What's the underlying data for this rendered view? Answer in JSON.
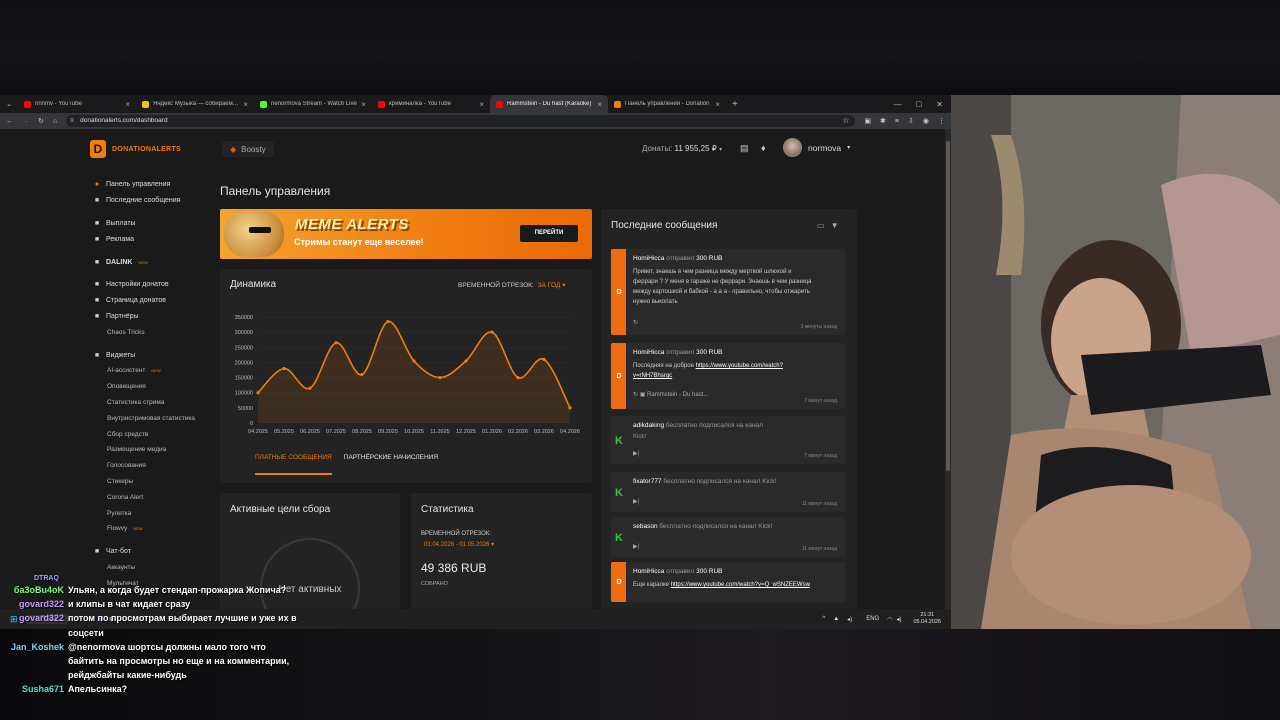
{
  "browser": {
    "tabs": [
      {
        "title": "nnnmv - YouTube",
        "icon": "youtube-icon",
        "color": "#ff0000"
      },
      {
        "title": "Яндекс Музыка — собираем мы",
        "icon": "yandex-music-icon",
        "color": "#f8c200"
      },
      {
        "title": "nenormova Stream - Watch Live",
        "icon": "kick-icon",
        "color": "#53fc18"
      },
      {
        "title": "криминалка - YouTube",
        "icon": "youtube-icon",
        "color": "#ff0000"
      },
      {
        "title": "Rammstein - Du hast (Karaoke)",
        "icon": "youtube-icon",
        "color": "#ff0000"
      },
      {
        "title": "Панель управления - Donation",
        "icon": "donationalerts-icon",
        "color": "#f57d07"
      }
    ],
    "url": "donationalerts.com/dashboard"
  },
  "topnav": {
    "logo": "DONATIONALERTS",
    "boosty": "Boosty",
    "donats_label": "Донаты:",
    "donats_value": "11 955,25 ₽",
    "username": "normova"
  },
  "sidebar": {
    "items": [
      {
        "label": "Панель управления",
        "icon": "dashboard-icon",
        "active": true
      },
      {
        "label": "Последние сообщения",
        "icon": "messages-icon"
      },
      {
        "label": "Выплаты",
        "icon": "payouts-icon"
      },
      {
        "label": "Реклама",
        "icon": "ads-icon"
      },
      {
        "label": "DALINK",
        "icon": "dalink-icon",
        "new": "NEW"
      },
      {
        "label": "Настройки донатов",
        "icon": "settings-icon"
      },
      {
        "label": "Страница донатов",
        "icon": "page-icon"
      },
      {
        "label": "Партнёры",
        "icon": "partners-icon"
      },
      {
        "label": "Chaos Tricks",
        "sub": true
      },
      {
        "label": "Виджеты",
        "icon": "widgets-icon"
      },
      {
        "label": "AI-ассистент",
        "sub": true,
        "new": "NEW"
      },
      {
        "label": "Оповещения",
        "sub": true
      },
      {
        "label": "Статистика стрима",
        "sub": true
      },
      {
        "label": "Внутристримовая статистика",
        "sub": true
      },
      {
        "label": "Сбор средств",
        "sub": true
      },
      {
        "label": "Размещение медиа",
        "sub": true
      },
      {
        "label": "Голосования",
        "sub": true
      },
      {
        "label": "Стикеры",
        "sub": true
      },
      {
        "label": "Corona Alert",
        "sub": true
      },
      {
        "label": "Рулетка",
        "sub": true
      },
      {
        "label": "Flowvy",
        "sub": true,
        "new": "NEW"
      },
      {
        "label": "Чат-бот",
        "icon": "bot-icon"
      },
      {
        "label": "Аккаунты",
        "sub": true
      },
      {
        "label": "Мультичат",
        "sub": true
      }
    ]
  },
  "main": {
    "title": "Панель управления",
    "banner": {
      "title": "MEME ALERTS",
      "subtitle": "Стримы станут еще веселее!",
      "button": "ПЕРЕЙТИ"
    },
    "dynamics": {
      "title": "Динамика",
      "period_label": "ВРЕМЕННОЙ ОТРЕЗОК:",
      "period_value": "ЗА ГОД",
      "tab_paid": "ПЛАТНЫЕ СООБЩЕНИЯ",
      "tab_partner": "ПАРТНЁРСКИЕ НАЧИСЛЕНИЯ"
    },
    "goals": {
      "title": "Активные цели сбора",
      "empty": "Нет активных"
    },
    "stats": {
      "title": "Статистика",
      "period_label": "ВРЕМЕННОЙ ОТРЕЗОК:",
      "period_value": "01.04.2026 - 01.05.2026",
      "sum": "49 386 RUB",
      "sum_label": "СОБРАНО"
    }
  },
  "chart_data": {
    "type": "line",
    "x": [
      "04.2025",
      "05.2025",
      "06.2025",
      "07.2025",
      "08.2025",
      "09.2025",
      "10.2025",
      "11.2025",
      "12.2025",
      "01.2026",
      "02.2026",
      "03.2026",
      "04.2026"
    ],
    "series": [
      {
        "values": [
          100000,
          180000,
          115000,
          265000,
          160000,
          335000,
          205000,
          150000,
          205000,
          300000,
          150000,
          210000,
          50000
        ]
      }
    ],
    "yticks": [
      0,
      50000,
      100000,
      150000,
      200000,
      250000,
      300000,
      350000
    ],
    "ylim": [
      0,
      350000
    ],
    "color": "#f57d07",
    "grid": true
  },
  "messages": {
    "title": "Последние сообщения",
    "items": [
      {
        "user": "HomiHicca",
        "action": "отправил",
        "amount": "300 RUB",
        "text": "Привет, знаешь в чем разница между мертвой шлюхой и феррари ? У меня в гараже не феррари. Знаешь в чем разница между картошкой и бабкой - а а а - правильно, чтобы отжарить нужно выкопать",
        "time": "3 минуты назад",
        "kind": "donation"
      },
      {
        "user": "HomiHicca",
        "action": "отправил",
        "amount": "300 RUB",
        "text": "Последняя на доброе",
        "link": "https://www.youtube.com/watch?v=rNH7Bhsrgc",
        "media": "Rammstein - Du hast...",
        "time": "7 минут назад",
        "kind": "donation"
      },
      {
        "user": "adikdaking",
        "action": "бесплатно подписался на канал",
        "extra": "Kick!",
        "time": "7 минут назад",
        "kind": "kick"
      },
      {
        "user": "fixator777",
        "action": "бесплатно подписался на канал Kick!",
        "time": "11 минут назад",
        "kind": "kick"
      },
      {
        "user": "sebason",
        "action": "бесплатно подписался на канал Kick!",
        "time": "11 минут назад",
        "kind": "kick"
      },
      {
        "user": "HomiHicca",
        "action": "отправил",
        "amount": "300 RUB",
        "text": "Еще караоке",
        "link": "https://www.youtube.com/watch?v=Q_wSNZEEWsw",
        "kind": "donation"
      }
    ]
  },
  "taskbar": {
    "lang": "ENG",
    "time": "21:31",
    "date": "05.04.2026"
  },
  "chat": [
    {
      "user": "DTRAQ",
      "color": "#a0a0ff",
      "text": ""
    },
    {
      "user": "ба3оBu4oK",
      "color": "#7cff7c",
      "text": "Ульян, а когда будет стендап-прожарка Жопича?"
    },
    {
      "user": "govard322",
      "color": "#c59cff",
      "text": "и клипы в чат кидает сразу"
    },
    {
      "user": "govard322",
      "color": "#c59cff",
      "text": "потом по просмотрам выбирает лучшие и уже их в соцсети"
    },
    {
      "user": "Jan_Koshek",
      "color": "#7fd0ff",
      "text": "@nenormova шортсы должны мало того что байтить на просмотры но еще и на комментарии, рейджбайты какие-нибудь"
    },
    {
      "user": "Susha671",
      "color": "#55e0d0",
      "text": "Апельсинка?"
    }
  ]
}
